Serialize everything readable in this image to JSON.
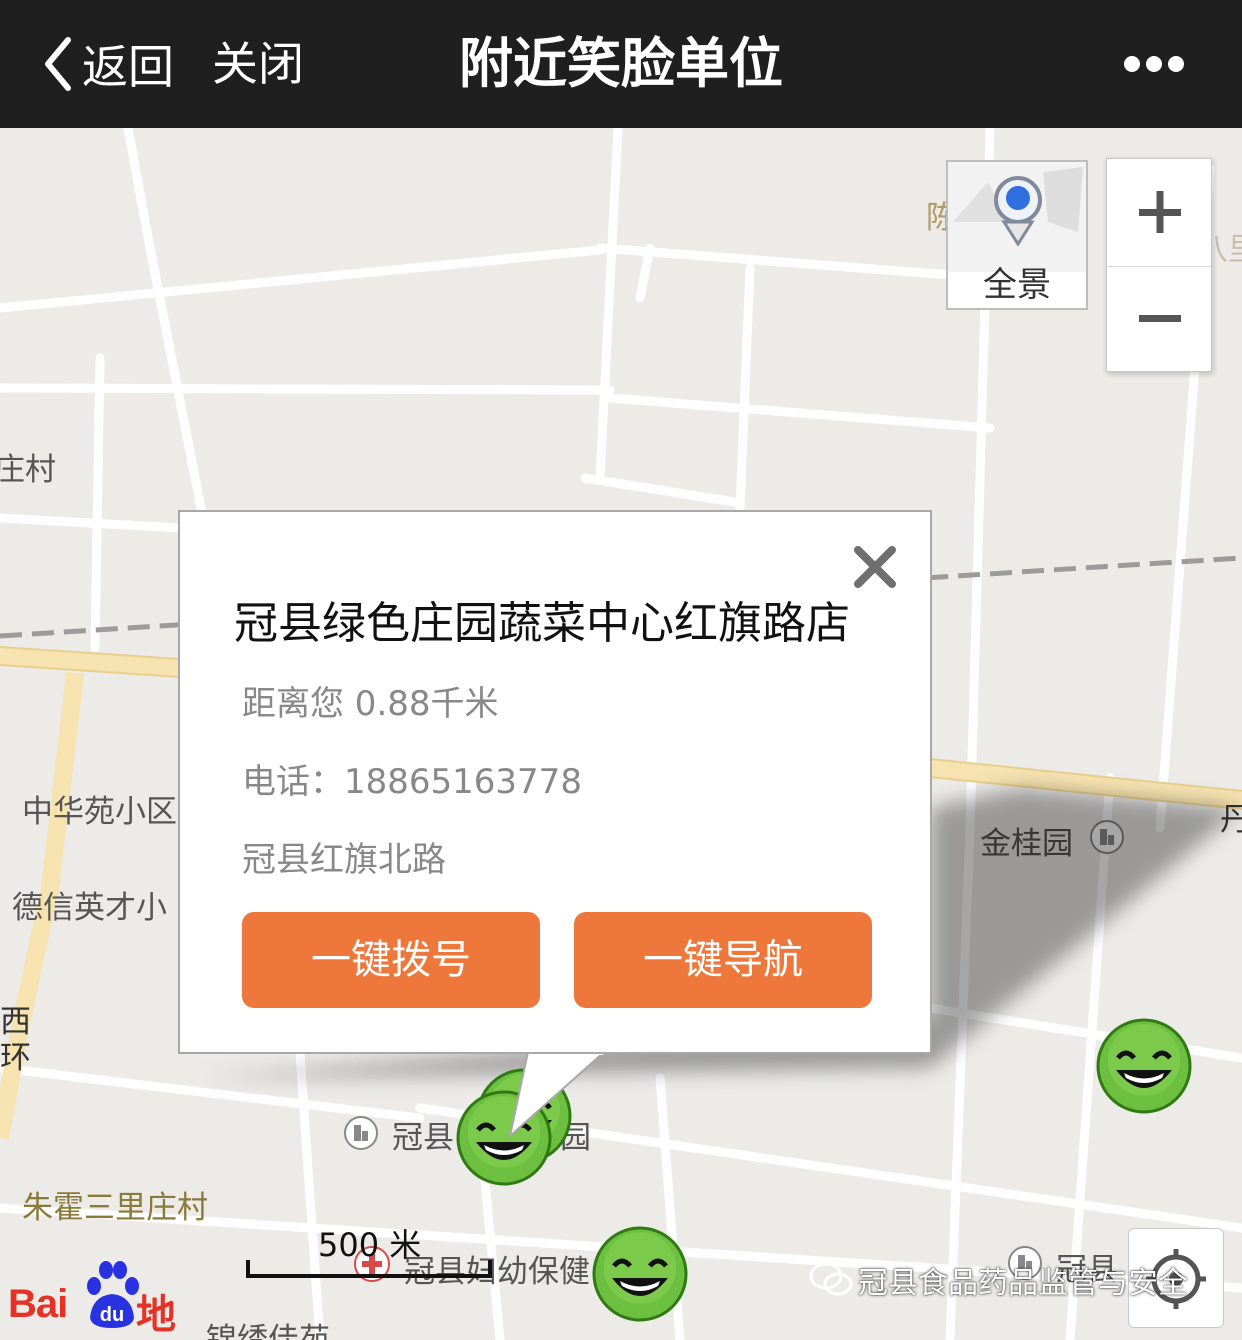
{
  "header": {
    "back_label": "返回",
    "close_label": "关闭",
    "title": "附近笑脸单位"
  },
  "map": {
    "panorama_label": "全景",
    "labels": {
      "village_left": "庄村",
      "gate_partial": "陈",
      "road_top_right": "邢八里",
      "zhonghua": "中华苑小区",
      "dexin": "德信英才小",
      "jingui": "金桂园",
      "road_right_partial": "丹",
      "guanxian_partial": "冠县",
      "garden_partial": "园",
      "zhuhuo": "朱霍三里庄村",
      "maternity": "冠县妇幼保健",
      "jinxiu": "锦绣佳苑",
      "guanxian_right": "冠县",
      "west_ring": "西环"
    },
    "scale_label": "500 米",
    "logo_bai": "Bai",
    "logo_du": "du",
    "logo_map": "地图",
    "icons": [
      "zoom-in-icon",
      "zoom-out-icon",
      "street-view-icon",
      "locate-icon",
      "smiley-marker-icon"
    ]
  },
  "popup": {
    "title": "冠县绿色庄园蔬菜中心红旗路店",
    "distance": "距离您 0.88千米",
    "phone": "电话：18865163778",
    "address": "冠县红旗北路",
    "call_button": "一键拨号",
    "navigate_button": "一键导航"
  },
  "watermark": {
    "text": "冠县食品药品监管与安全"
  },
  "colors": {
    "topbar": "#1f1f20",
    "button": "#ee773b",
    "map_bg": "#ecebe8",
    "road_yellow": "#f7e3b0",
    "baidu_red": "#e63125",
    "baidu_blue": "#2932e1",
    "smiley_green": "#5aa832"
  }
}
